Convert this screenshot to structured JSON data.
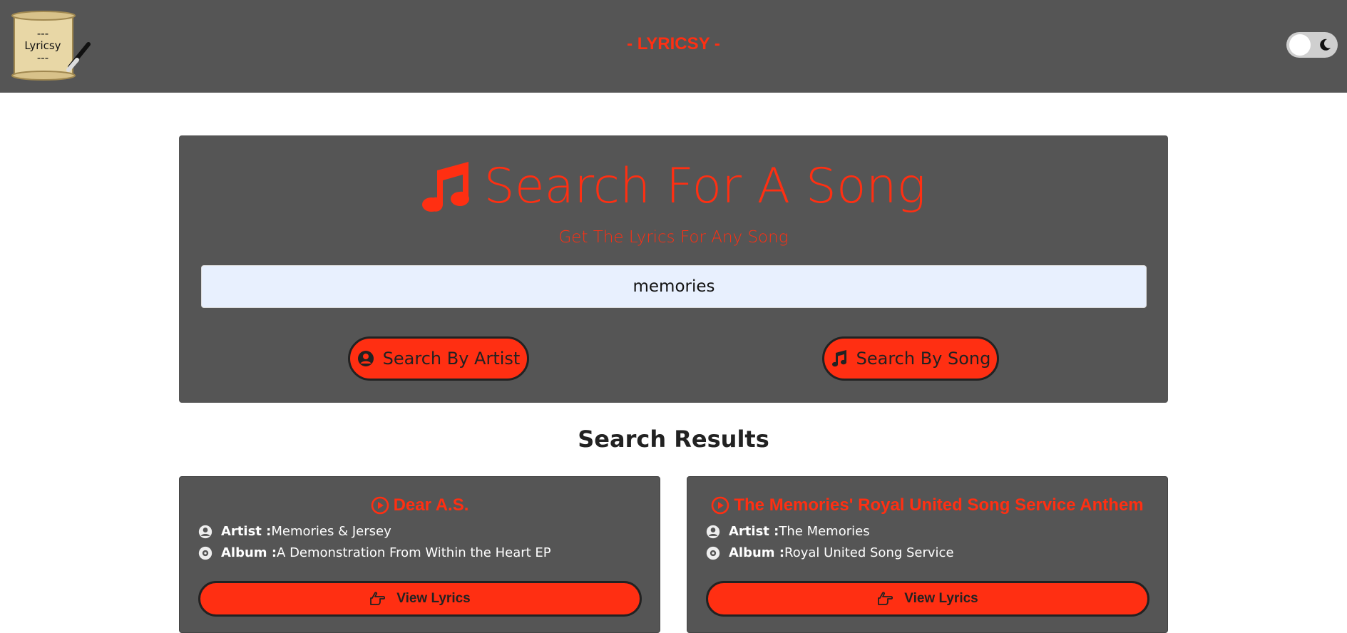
{
  "navbar": {
    "logo_lines": [
      "---",
      "Lyricsy",
      "---"
    ],
    "brand": "- LYRICSY -"
  },
  "hero": {
    "title": "Search For A Song",
    "subtitle": "Get The Lyrics For Any Song"
  },
  "search": {
    "value": "memories",
    "by_artist_label": "Search By Artist",
    "by_song_label": "Search By Song"
  },
  "results": {
    "heading": "Search Results",
    "items": [
      {
        "title": "Dear A.S.",
        "artist_label": "Artist :",
        "artist": "Memories & Jersey",
        "album_label": "Album :",
        "album": "A Demonstration From Within the Heart EP",
        "button_label": "View Lyrics"
      },
      {
        "title": "The Memories' Royal United Song Service Anthem",
        "artist_label": "Artist :",
        "artist": "The Memories",
        "album_label": "Album :",
        "album": "Royal United Song Service",
        "button_label": "View Lyrics"
      }
    ]
  },
  "colors": {
    "accent": "#ff2f12",
    "panel": "#555555",
    "input_bg": "#e8f0fe"
  },
  "icons": {
    "hero": "music-note-icon",
    "artist": "user-circle-icon",
    "song": "music-note-icon",
    "play": "play-circle-icon",
    "album": "disc-icon",
    "view": "hand-pointing-icon",
    "theme": "moon-icon"
  }
}
